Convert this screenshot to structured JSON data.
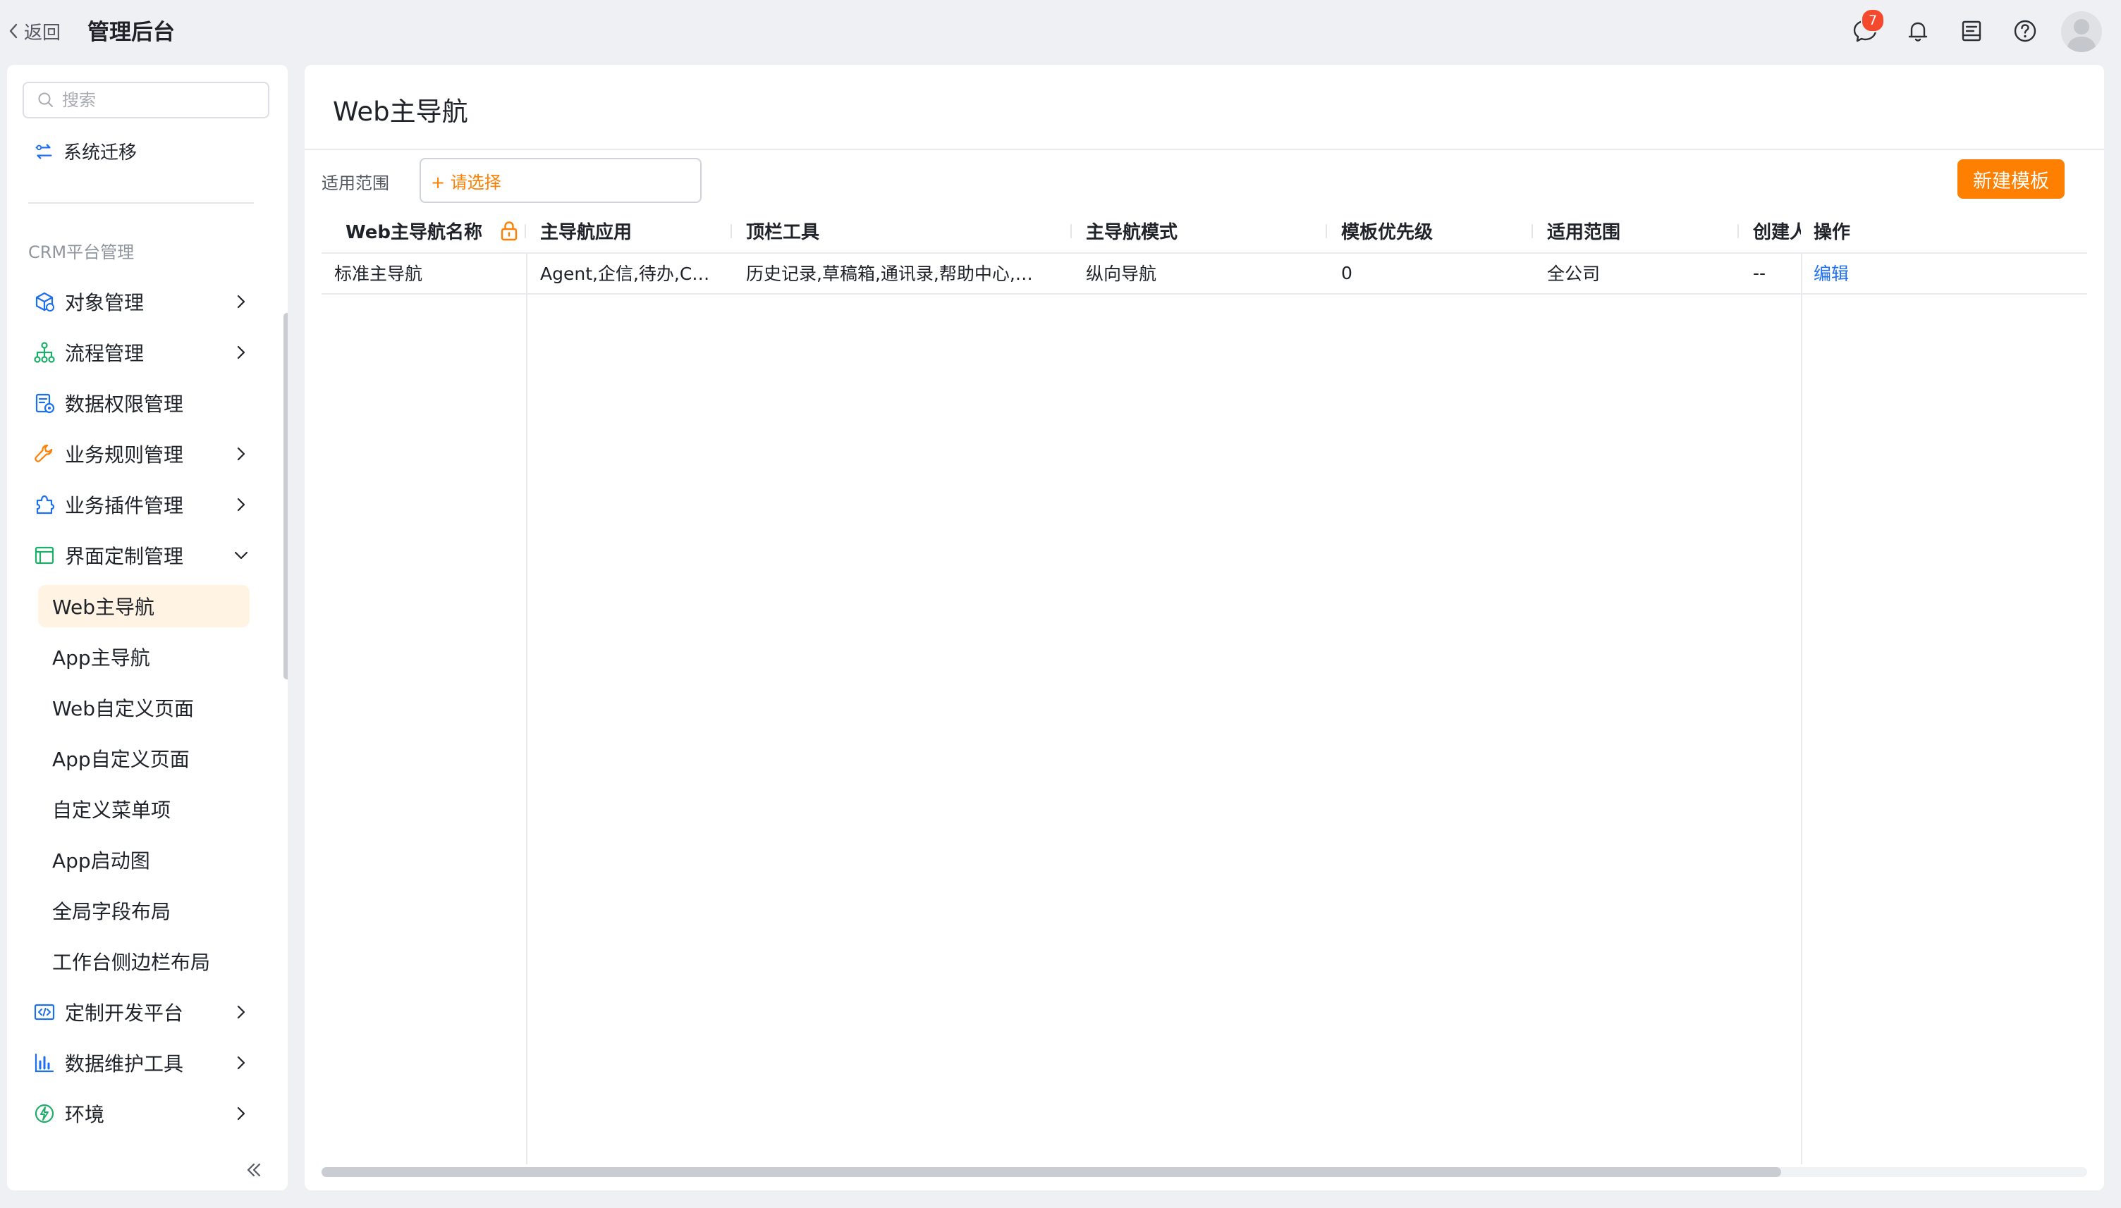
{
  "topbar": {
    "back_label": "返回",
    "title": "管理后台",
    "message_badge": "7",
    "icons": [
      "message-icon",
      "bell-icon",
      "inbox-icon",
      "help-icon",
      "avatar"
    ]
  },
  "sidebar": {
    "search_placeholder": "搜索",
    "migrate_label": "系统迁移",
    "section_title": "CRM平台管理",
    "items": [
      {
        "label": "对象管理",
        "icon": "cube-icon"
      },
      {
        "label": "流程管理",
        "icon": "flow-icon"
      },
      {
        "label": "数据权限管理",
        "icon": "data-permission-icon"
      },
      {
        "label": "业务规则管理",
        "icon": "wrench-icon"
      },
      {
        "label": "业务插件管理",
        "icon": "puzzle-icon"
      },
      {
        "label": "界面定制管理",
        "icon": "window-icon"
      }
    ],
    "sub_items": [
      {
        "label": "Web主导航",
        "active": true
      },
      {
        "label": "App主导航"
      },
      {
        "label": "Web自定义页面"
      },
      {
        "label": "App自定义页面"
      },
      {
        "label": "自定义菜单项"
      },
      {
        "label": "App启动图"
      },
      {
        "label": "全局字段布局"
      },
      {
        "label": "工作台侧边栏布局"
      }
    ],
    "bottom_items": [
      {
        "label": "定制开发平台",
        "icon": "code-icon"
      },
      {
        "label": "数据维护工具",
        "icon": "bar-chart-icon"
      },
      {
        "label": "环境",
        "icon": "environment-icon"
      }
    ]
  },
  "main": {
    "title": "Web主导航",
    "filter_label": "适用范围",
    "filter_placeholder": "+ 请选择",
    "new_button": "新建模板",
    "columns": [
      "Web主导航名称",
      "主导航应用",
      "顶栏工具",
      "主导航模式",
      "模板优先级",
      "适用范围",
      "创建人",
      "操作"
    ],
    "rows": [
      {
        "name": "标准主导航",
        "apps": "Agent,企信,待办,C…",
        "tools": "历史记录,草稿箱,通讯录,帮助中心,…",
        "mode": "纵向导航",
        "priority": "0",
        "scope": "全公司",
        "creator": "--",
        "action": "编辑"
      }
    ]
  },
  "colors": {
    "accent": "#ff7f00",
    "link": "#1d6ff2",
    "badge": "#f5492d",
    "active_bg": "#fff3e3"
  }
}
